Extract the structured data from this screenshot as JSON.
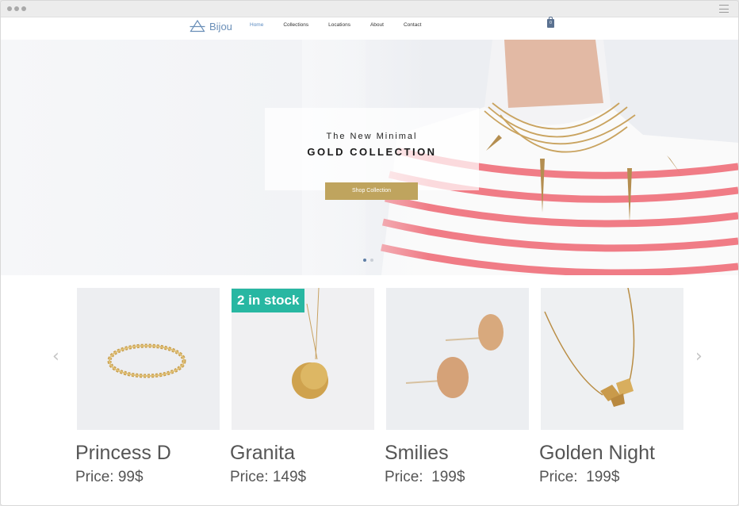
{
  "window": {
    "title": ""
  },
  "nav": {
    "logo": "Bijou",
    "links": [
      "Home",
      "Collections",
      "Locations",
      "About",
      "Contact"
    ],
    "cart_count": "0"
  },
  "hero": {
    "subtitle": "The New Minimal",
    "title": "GOLD COLLECTION",
    "button": "Shop Collection",
    "slides": 2,
    "active_slide": 1
  },
  "badge": "2 in stock",
  "products": [
    {
      "name": "Princess D",
      "price": "Price: 99$"
    },
    {
      "name": "Granita",
      "price": "Price: 149$"
    },
    {
      "name": "Smilies",
      "price": "Price:  199$"
    },
    {
      "name": "Golden Night",
      "price": "Price:  199$"
    }
  ],
  "icons": {
    "menu": "hamburger-icon",
    "cart": "shopping-bag-icon",
    "prev": "chevron-left-icon",
    "next": "chevron-right-icon"
  },
  "colors": {
    "accent": "#bfa45e",
    "badge": "#28b7a2",
    "logo": "#6a8fb8"
  }
}
